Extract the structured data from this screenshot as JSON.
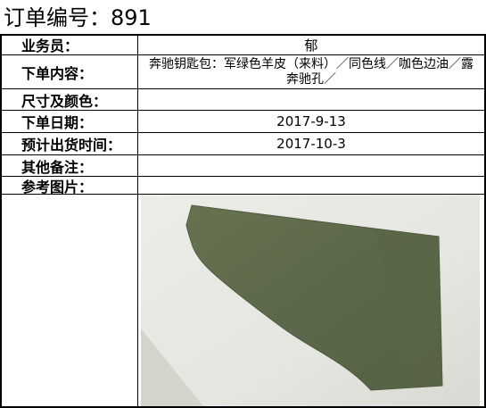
{
  "order": {
    "title": "订单编号：891"
  },
  "fields": [
    {
      "label": "业务员：",
      "value": "郁"
    },
    {
      "label": "下单内容：",
      "value": "奔驰钥匙包：军绿色羊皮（来料）／同色线／咖色边油／露奔驰孔／"
    },
    {
      "label": "尺寸及颜色：",
      "value": ""
    },
    {
      "label": "下单日期：",
      "value": "2017-9-13"
    },
    {
      "label": "预计出货时间：",
      "value": "2017-10-3"
    },
    {
      "label": "其他备注：",
      "value": ""
    },
    {
      "label": "参考图片：",
      "value": ""
    }
  ],
  "photo": {
    "subject": "military-green leather piece on white table",
    "leather_color": "#5e6b4e",
    "background_color": "#e9e9e4"
  }
}
